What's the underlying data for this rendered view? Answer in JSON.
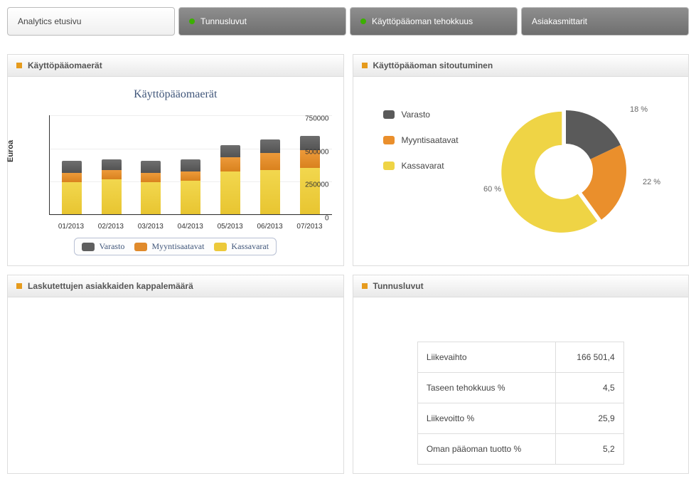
{
  "tabs": [
    {
      "label": "Analytics etusivu",
      "active": true,
      "dot": null
    },
    {
      "label": "Tunnusluvut",
      "active": false,
      "dot": "green"
    },
    {
      "label": "Käyttöpääoman tehokkuus",
      "active": false,
      "dot": "green"
    },
    {
      "label": "Asiakasmittarit",
      "active": false,
      "dot": null
    }
  ],
  "cards": {
    "kpe": {
      "title": "Käyttöpääomaerät"
    },
    "sit": {
      "title": "Käyttöpääoman sitoutuminen"
    },
    "lasku": {
      "title": "Laskutettujen asiakkaiden kappalemäärä"
    },
    "tunnus": {
      "title": "Tunnusluvut"
    }
  },
  "chart_data": [
    {
      "id": "stacked_bar",
      "type": "bar",
      "stacked": true,
      "title": "Käyttöpääomaerät",
      "ylabel": "Euroa",
      "ylim": [
        0,
        750000
      ],
      "yticks": [
        0,
        250000,
        500000,
        750000
      ],
      "categories": [
        "01/2013",
        "02/2013",
        "03/2013",
        "04/2013",
        "05/2013",
        "06/2013",
        "07/2013"
      ],
      "series": [
        {
          "name": "Kassavarat",
          "color": "#ecc93a",
          "values": [
            240000,
            260000,
            240000,
            250000,
            320000,
            330000,
            350000
          ]
        },
        {
          "name": "Myyntisaatavat",
          "color": "#e08a2b",
          "values": [
            70000,
            70000,
            70000,
            70000,
            110000,
            130000,
            130000
          ]
        },
        {
          "name": "Varasto",
          "color": "#5f5f5f",
          "values": [
            90000,
            80000,
            90000,
            90000,
            90000,
            100000,
            110000
          ]
        }
      ],
      "legend_order": [
        "Varasto",
        "Myyntisaatavat",
        "Kassavarat"
      ]
    },
    {
      "id": "donut",
      "type": "pie",
      "donut": true,
      "series": [
        {
          "name": "Varasto",
          "value": 18,
          "label": "18 %",
          "color": "#5a5a5a"
        },
        {
          "name": "Myyntisaatavat",
          "value": 22,
          "label": "22 %",
          "color": "#ea8f2c"
        },
        {
          "name": "Kassavarat",
          "value": 60,
          "label": "60 %",
          "color": "#efd445"
        }
      ]
    },
    {
      "id": "kpi_table",
      "type": "table",
      "rows": [
        {
          "label": "Liikevaihto",
          "value": "166 501,4"
        },
        {
          "label": "Taseen tehokkuus %",
          "value": "4,5"
        },
        {
          "label": "Liikevoitto %",
          "value": "25,9"
        },
        {
          "label": "Oman pääoman tuotto %",
          "value": "5,2"
        }
      ]
    }
  ]
}
